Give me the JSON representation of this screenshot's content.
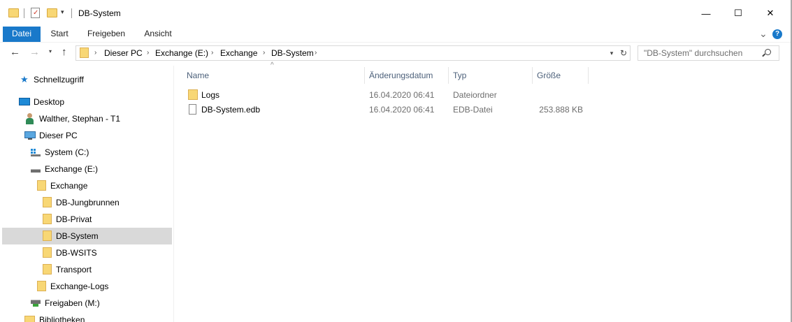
{
  "window": {
    "title": "DB-System",
    "minimize_glyph": "—",
    "maximize_glyph": "☐",
    "close_glyph": "✕"
  },
  "ribbon": {
    "tabs": [
      {
        "label": "Datei"
      },
      {
        "label": "Start"
      },
      {
        "label": "Freigeben"
      },
      {
        "label": "Ansicht"
      }
    ],
    "expand_glyph": "⌄",
    "help_glyph": "?"
  },
  "address": {
    "crumbs": [
      "Dieser PC",
      "Exchange (E:)",
      "Exchange",
      "DB-System"
    ],
    "search_placeholder": "\"DB-System\" durchsuchen"
  },
  "nav": {
    "items": [
      {
        "label": "Schnellzugriff",
        "icon": "star-icon"
      },
      {
        "label": "Desktop",
        "icon": "desktop-icon"
      },
      {
        "label": "Walther, Stephan - T1",
        "icon": "user-icon"
      },
      {
        "label": "Dieser PC",
        "icon": "computer-icon"
      },
      {
        "label": "System (C:)",
        "icon": "windows-drive-icon"
      },
      {
        "label": "Exchange (E:)",
        "icon": "drive-icon"
      },
      {
        "label": "Exchange",
        "icon": "folder-icon"
      },
      {
        "label": "DB-Jungbrunnen",
        "icon": "folder-icon"
      },
      {
        "label": "DB-Privat",
        "icon": "folder-icon"
      },
      {
        "label": "DB-System",
        "icon": "folder-icon",
        "selected": true
      },
      {
        "label": "DB-WSITS",
        "icon": "folder-icon"
      },
      {
        "label": "Transport",
        "icon": "folder-icon"
      },
      {
        "label": "Exchange-Logs",
        "icon": "folder-icon"
      },
      {
        "label": "Freigaben (M:)",
        "icon": "network-drive-icon"
      },
      {
        "label": "Bibliotheken",
        "icon": "library-icon"
      }
    ]
  },
  "list": {
    "columns": [
      "Name",
      "Änderungsdatum",
      "Typ",
      "Größe"
    ],
    "rows": [
      {
        "name": "Logs",
        "date": "16.04.2020 06:41",
        "type": "Dateiordner",
        "size": "",
        "icon": "folder-icon"
      },
      {
        "name": "DB-System.edb",
        "date": "16.04.2020 06:41",
        "type": "EDB-Datei",
        "size": "253.888 KB",
        "icon": "file-icon"
      }
    ],
    "sort_glyph": "^"
  },
  "colors": {
    "accent": "#1979ca",
    "selected_bg": "#d9d9d9",
    "folder": "#f8d775",
    "header_text": "#4c607a"
  }
}
